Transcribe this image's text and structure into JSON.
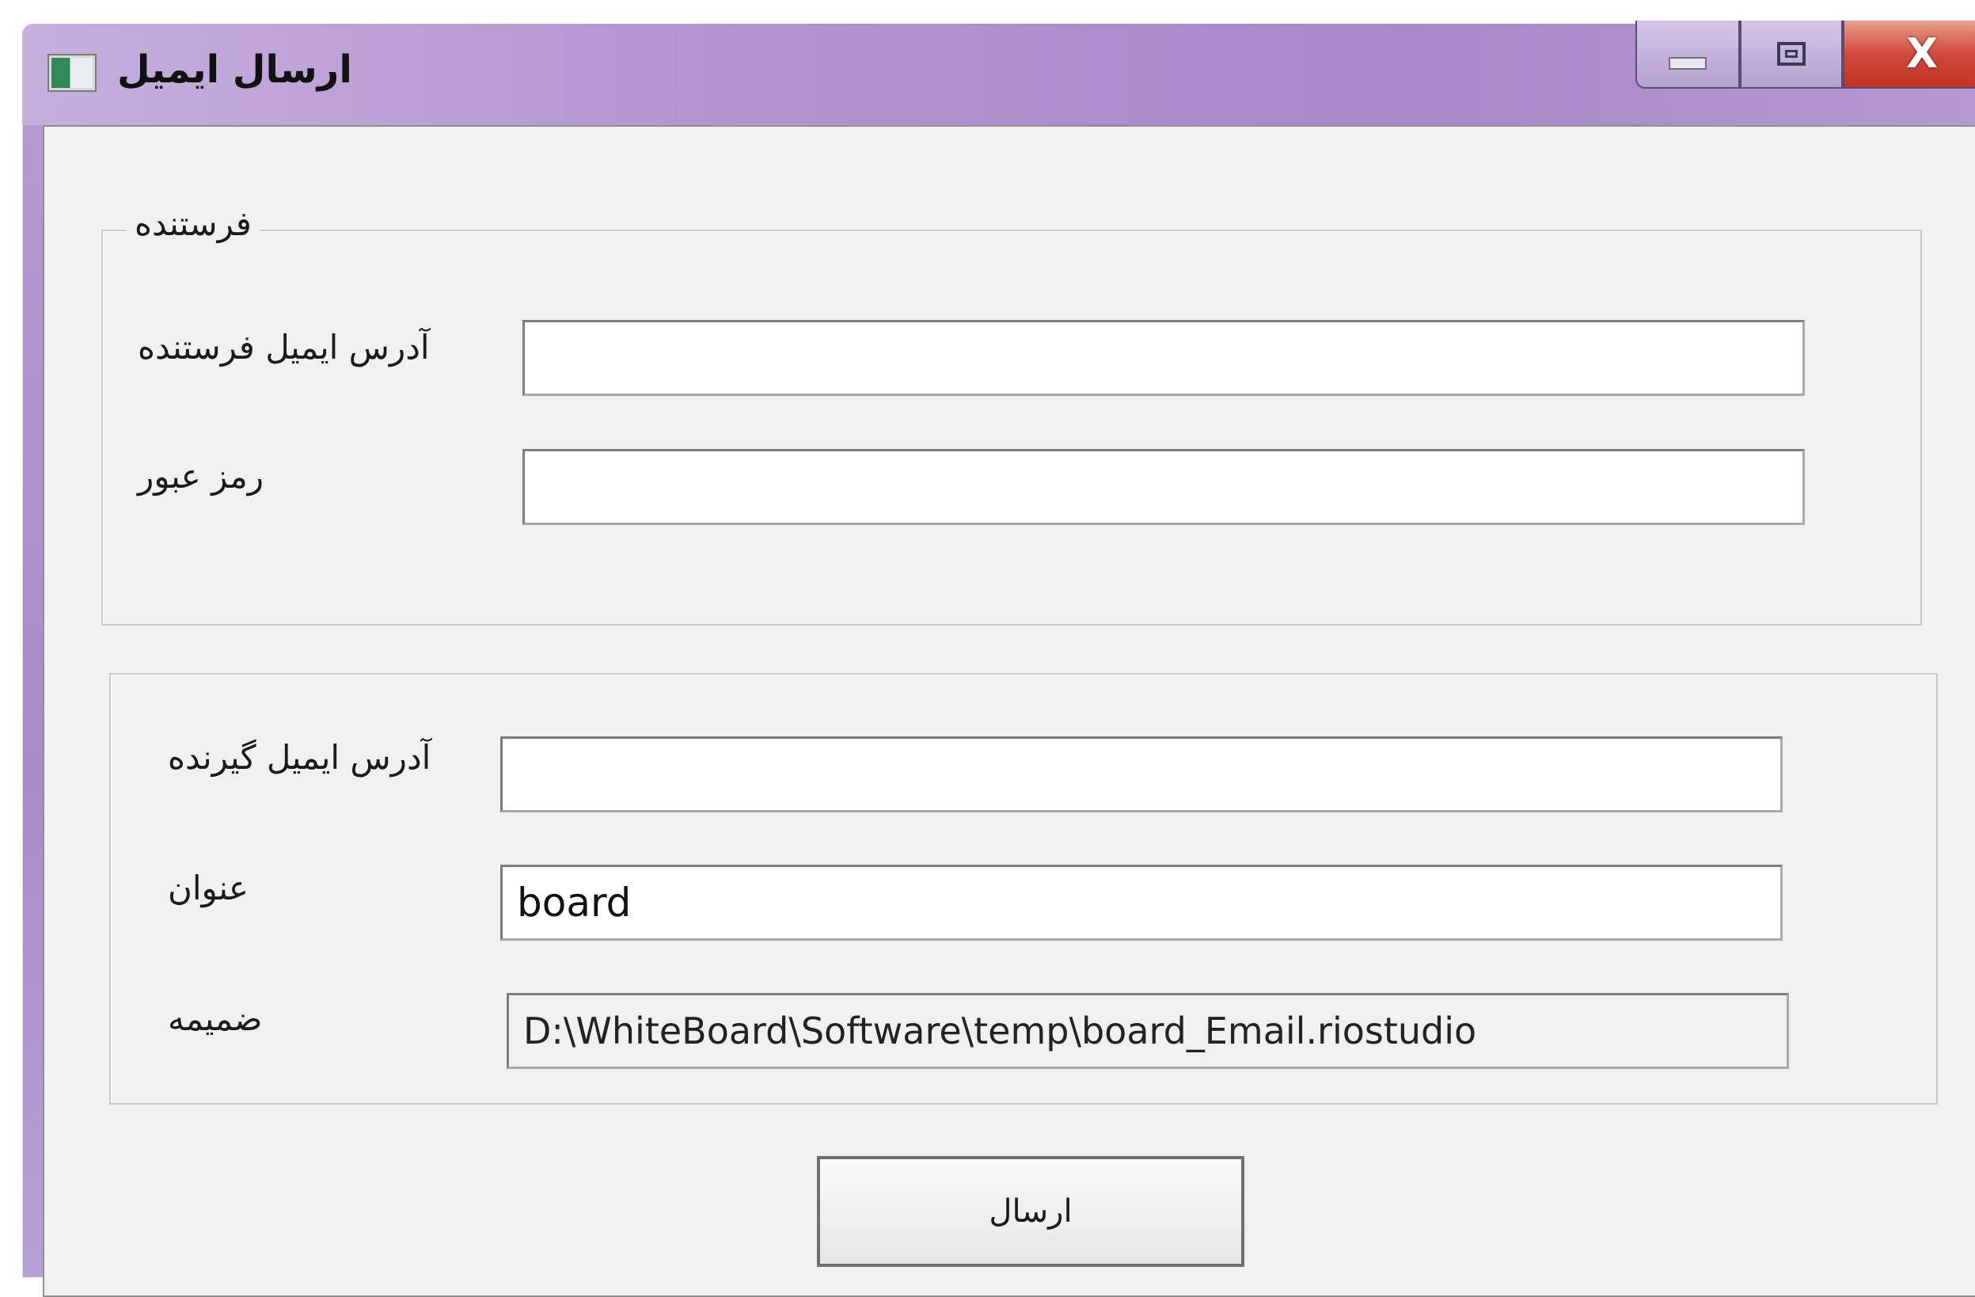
{
  "window": {
    "title": "ارسال ایمیل",
    "controls": {
      "minimize": "minimize",
      "maximize": "maximize",
      "close": "X"
    }
  },
  "sender_group": {
    "legend": "فرستنده",
    "email_label": "آدرس ایمیل فرستنده",
    "email_value": "",
    "password_label": "رمز عبور",
    "password_value": ""
  },
  "message_group": {
    "recipient_label": "آدرس ایمیل گیرنده",
    "recipient_value": "",
    "subject_label": "عنوان",
    "subject_value": "board",
    "attachment_label": "ضمیمه",
    "attachment_value": "D:\\WhiteBoard\\Software\\temp\\board_Email.riostudio"
  },
  "send_button": {
    "label": "ارسال"
  },
  "colors": {
    "titlebar": "#b493d2",
    "close_button": "#c13526",
    "client_background": "#f0f0f0"
  },
  "icons": {
    "app": "window-app-icon",
    "minimize": "minimize-icon",
    "maximize": "maximize-icon",
    "close": "close-icon"
  }
}
